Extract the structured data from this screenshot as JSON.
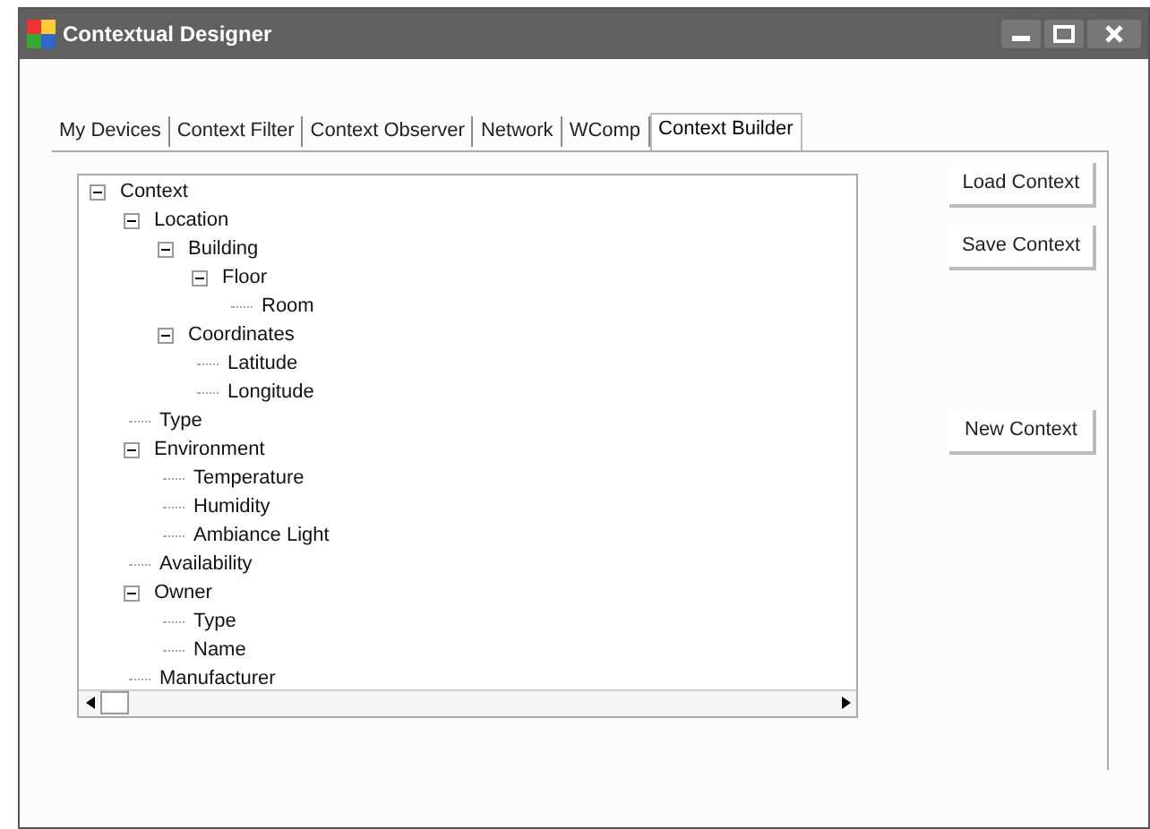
{
  "window": {
    "title": "Contextual Designer"
  },
  "tabs": [
    {
      "label": "My Devices",
      "selected": false
    },
    {
      "label": "Context Filter",
      "selected": false
    },
    {
      "label": "Context Observer",
      "selected": false
    },
    {
      "label": "Network",
      "selected": false
    },
    {
      "label": "WComp",
      "selected": false
    },
    {
      "label": "Context Builder",
      "selected": true
    }
  ],
  "tree": [
    {
      "label": "Context",
      "expanded": true,
      "children": [
        {
          "label": "Location",
          "expanded": true,
          "children": [
            {
              "label": "Building",
              "expanded": true,
              "children": [
                {
                  "label": "Floor",
                  "expanded": true,
                  "children": [
                    {
                      "label": "Room"
                    }
                  ]
                }
              ]
            },
            {
              "label": "Coordinates",
              "expanded": true,
              "children": [
                {
                  "label": "Latitude"
                },
                {
                  "label": "Longitude"
                }
              ]
            }
          ]
        },
        {
          "label": "Type"
        },
        {
          "label": "Environment",
          "expanded": true,
          "children": [
            {
              "label": "Temperature"
            },
            {
              "label": "Humidity"
            },
            {
              "label": "Ambiance Light"
            }
          ]
        },
        {
          "label": "Availability"
        },
        {
          "label": "Owner",
          "expanded": true,
          "children": [
            {
              "label": "Type"
            },
            {
              "label": "Name"
            }
          ]
        },
        {
          "label": "Manufacturer"
        }
      ]
    }
  ],
  "buttons": [
    "Load Context",
    "Save Context",
    "New Context"
  ]
}
